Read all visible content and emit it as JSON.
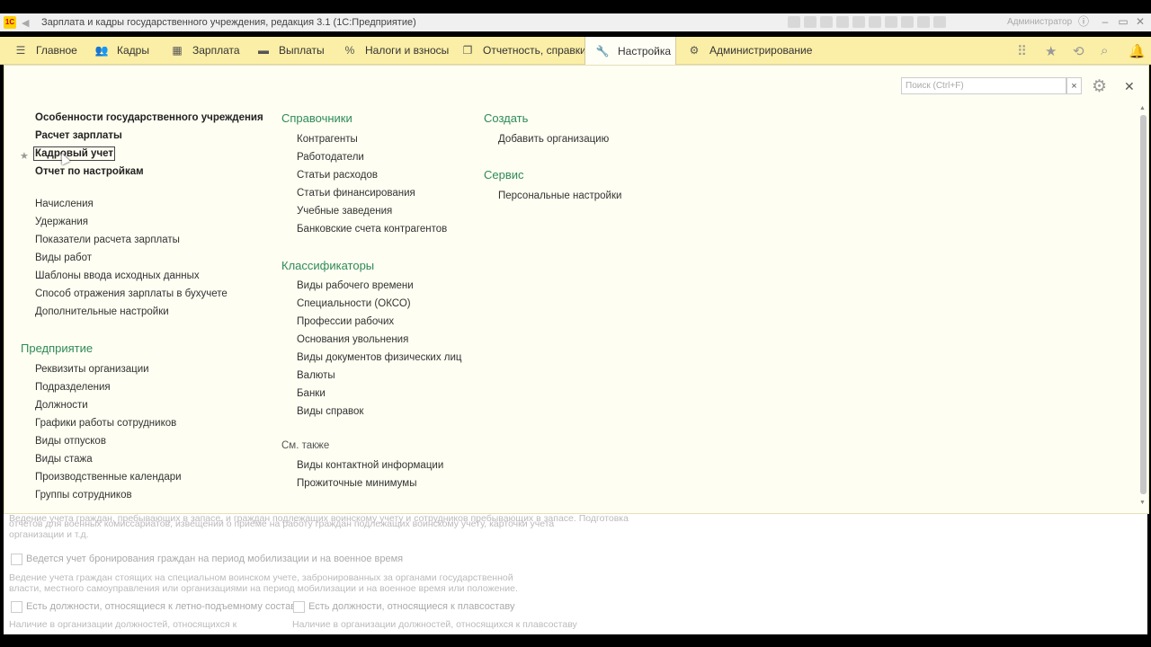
{
  "window": {
    "title": "Зарплата и кадры государственного учреждения, редакция 3.1  (1С:Предприятие)",
    "user": "Администратор"
  },
  "menu": {
    "items": [
      {
        "label": "Главное",
        "icon": "hamburger-icon"
      },
      {
        "label": "Кадры",
        "icon": "people-icon"
      },
      {
        "label": "Зарплата",
        "icon": "calculator-icon"
      },
      {
        "label": "Выплаты",
        "icon": "wallet-icon"
      },
      {
        "label": "Налоги и взносы",
        "icon": "percent-icon"
      },
      {
        "label": "Отчетность, справки",
        "icon": "reports-icon"
      },
      {
        "label": "Настройка",
        "icon": "wrench-icon"
      },
      {
        "label": "Администрирование",
        "icon": "gear-icon"
      }
    ],
    "active": "Настройка"
  },
  "search": {
    "placeholder": "Поиск (Ctrl+F)",
    "clear": "×"
  },
  "col1": {
    "bold": [
      "Особенности государственного учреждения",
      "Расчет зарплаты",
      "Кадровый учет",
      "Отчет по настройкам"
    ],
    "links": [
      "Начисления",
      "Удержания",
      "Показатели расчета зарплаты",
      "Виды работ",
      "Шаблоны ввода исходных данных",
      "Способ отражения зарплаты в бухучете",
      "Дополнительные настройки"
    ],
    "section2": "Предприятие",
    "links2": [
      "Реквизиты организации",
      "Подразделения",
      "Должности",
      "Графики работы сотрудников",
      "Виды отпусков",
      "Виды стажа",
      "Производственные календари",
      "Группы сотрудников"
    ]
  },
  "col2": {
    "section1": "Справочники",
    "links1": [
      "Контрагенты",
      "Работодатели",
      "Статьи расходов",
      "Статьи финансирования",
      "Учебные заведения",
      "Банковские счета контрагентов"
    ],
    "section2": "Классификаторы",
    "links2": [
      "Виды рабочего времени",
      "Специальности (ОКСО)",
      "Профессии рабочих",
      "Основания увольнения",
      "Виды документов физических лиц",
      "Валюты",
      "Банки",
      "Виды справок"
    ],
    "see_also": "См. также",
    "links3": [
      "Виды контактной информации",
      "Прожиточные минимумы"
    ]
  },
  "col3": {
    "section1": "Создать",
    "links1": [
      "Добавить организацию"
    ],
    "section2": "Сервис",
    "links2": [
      "Персональные настройки"
    ]
  },
  "background_form": {
    "line1": "Ведение учета граждан, пребывающих в запасе, и граждан подлежащих воинскому учету и сотрудников пребывающих в запасе. Подготовка",
    "line2": "отчетов для военных комиссариатов, извещений о приеме на работу граждан подлежащих воинскому учету, карточки учета",
    "line3": "организации и т.д.",
    "checkbox1": "Ведется учет бронирования граждан на период мобилизации и на военное время",
    "desc1a": "Ведение учета граждан стоящих на специальном воинском учете, забронированных за органами государственной",
    "desc1b": "власти, местного самоуправления или организациями на период мобилизации и на военное время или положение.",
    "checkbox2": "Есть должности, относящиеся к летно-подъемному составу",
    "checkbox3": "Есть должности, относящиеся к плавсоставу",
    "desc2": "Наличие в организации должностей, относящихся к",
    "desc3": "Наличие в организации должностей, относящихся к плавсоставу"
  }
}
